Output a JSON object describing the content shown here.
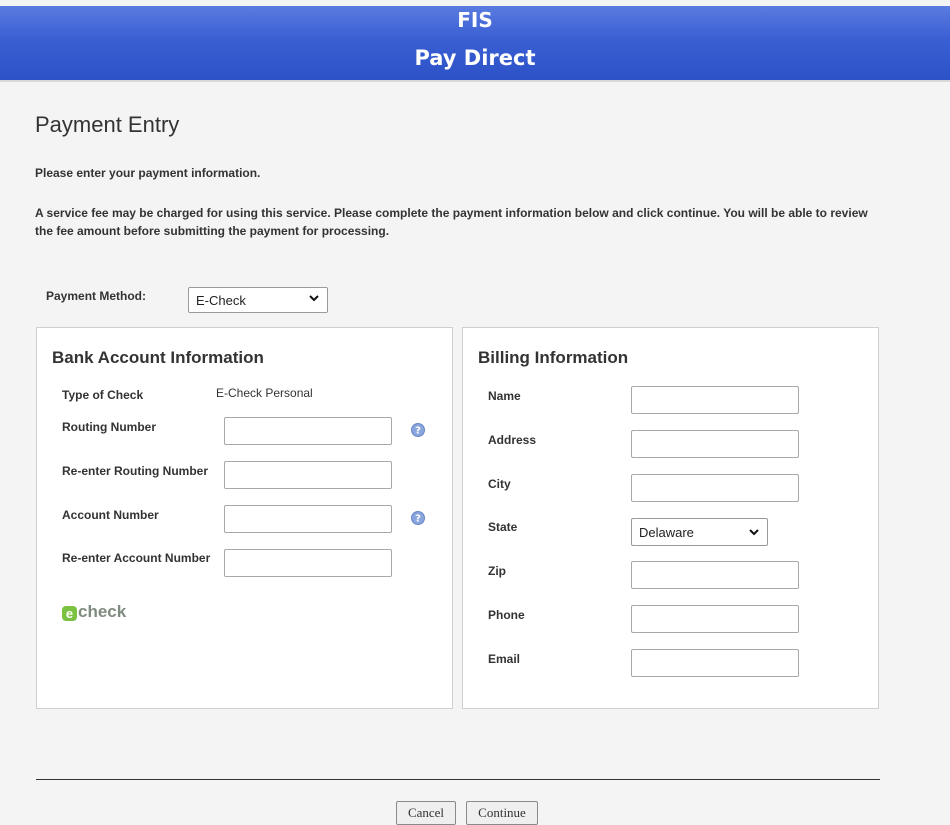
{
  "header": {
    "line1": "FIS",
    "line2": "Pay Direct"
  },
  "page": {
    "title": "Payment Entry",
    "intro": "Please enter your payment information.",
    "fee_note": "A service fee may be charged for using this service. Please complete the payment information below and click continue. You will be able to review the fee amount before submitting the payment for processing."
  },
  "payment_method": {
    "label": "Payment Method:",
    "selected": "E-Check"
  },
  "bank": {
    "title": "Bank Account Information",
    "type_label": "Type of Check",
    "type_value": "E-Check Personal",
    "routing_label": "Routing Number",
    "routing_confirm_label": "Re-enter Routing Number",
    "account_label": "Account Number",
    "account_confirm_label": "Re-enter Account Number",
    "logo_text": "check",
    "logo_badge": "e"
  },
  "billing": {
    "title": "Billing Information",
    "name_label": "Name",
    "address_label": "Address",
    "city_label": "City",
    "state_label": "State",
    "state_selected": "Delaware",
    "zip_label": "Zip",
    "phone_label": "Phone",
    "email_label": "Email"
  },
  "actions": {
    "cancel": "Cancel",
    "continue": "Continue"
  },
  "colors": {
    "header_blue": "#3a5fd3",
    "help_icon": "#7a9ad6",
    "echeck_green": "#7cc242"
  },
  "icons": {
    "help": "question-circle-icon",
    "dropdown": "chevron-down-icon"
  }
}
